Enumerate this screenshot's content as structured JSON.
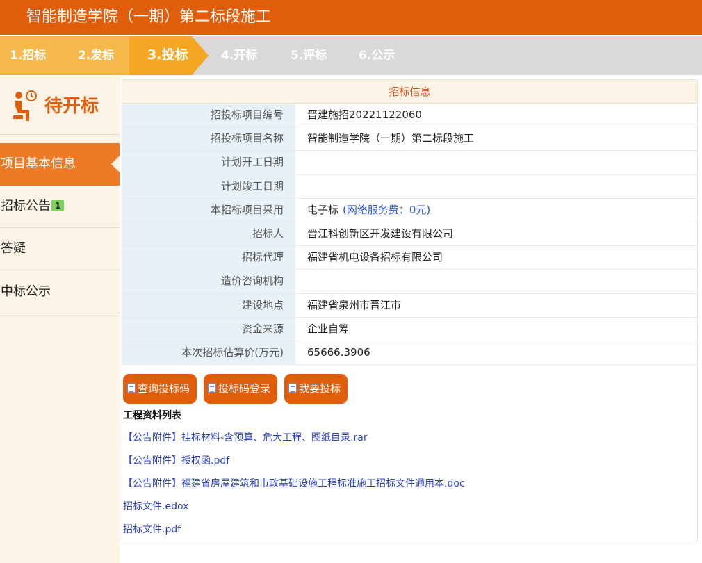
{
  "header": {
    "title": "智能制造学院（一期）第二标段施工"
  },
  "steps": [
    {
      "label": "1.招标",
      "state": "done"
    },
    {
      "label": "2.发标",
      "state": "done"
    },
    {
      "label": "3.投标",
      "state": "current"
    },
    {
      "label": "4.开标",
      "state": "pending"
    },
    {
      "label": "5.评标",
      "state": "pending"
    },
    {
      "label": "6.公示",
      "state": "pending"
    }
  ],
  "sidebar": {
    "status": "待开标",
    "status_icon": "waiting-person-clock-icon",
    "items": [
      {
        "label": "项目基本信息",
        "active": true
      },
      {
        "label": "招标公告",
        "badge": "1"
      },
      {
        "label": "答疑"
      },
      {
        "label": "中标公示"
      }
    ]
  },
  "info": {
    "title": "招标信息",
    "rows": [
      {
        "label": "招投标项目编号",
        "value": "晋建施招20221122060"
      },
      {
        "label": "招投标项目名称",
        "value": "智能制造学院（一期）第二标段施工"
      },
      {
        "label": "计划开工日期",
        "value": ""
      },
      {
        "label": "计划竣工日期",
        "value": ""
      },
      {
        "label": "本招标项目采用",
        "value": "电子标",
        "extra": "(网络服务费：0元)"
      },
      {
        "label": "招标人",
        "value": "晋江科创新区开发建设有限公司"
      },
      {
        "label": "招标代理",
        "value": "福建省机电设备招标有限公司"
      },
      {
        "label": "造价咨询机构",
        "value": ""
      },
      {
        "label": "建设地点",
        "value": "福建省泉州市晋江市"
      },
      {
        "label": "资金来源",
        "value": "企业自筹"
      },
      {
        "label": "本次招标估算价(万元)",
        "value": "65666.3906"
      }
    ]
  },
  "buttons": {
    "query_code": "查询投标码",
    "code_login": "投标码登录",
    "submit_bid": "我要投标"
  },
  "files": {
    "title": "工程资料列表",
    "items": [
      "【公告附件】挂标材料-含预算、危大工程、图纸目录.rar",
      "【公告附件】授权函.pdf",
      "【公告附件】福建省房屋建筑和市政基础设施工程标准施工招标文件通用本.doc",
      "招标文件.edox",
      "招标文件.pdf"
    ]
  },
  "colors": {
    "header": "#e05d0c",
    "step_done": "#f7b84b",
    "step_current": "#f5a623",
    "step_pending": "#d9d9d9",
    "accent": "#ee7a26",
    "link": "#2a3fc0"
  }
}
